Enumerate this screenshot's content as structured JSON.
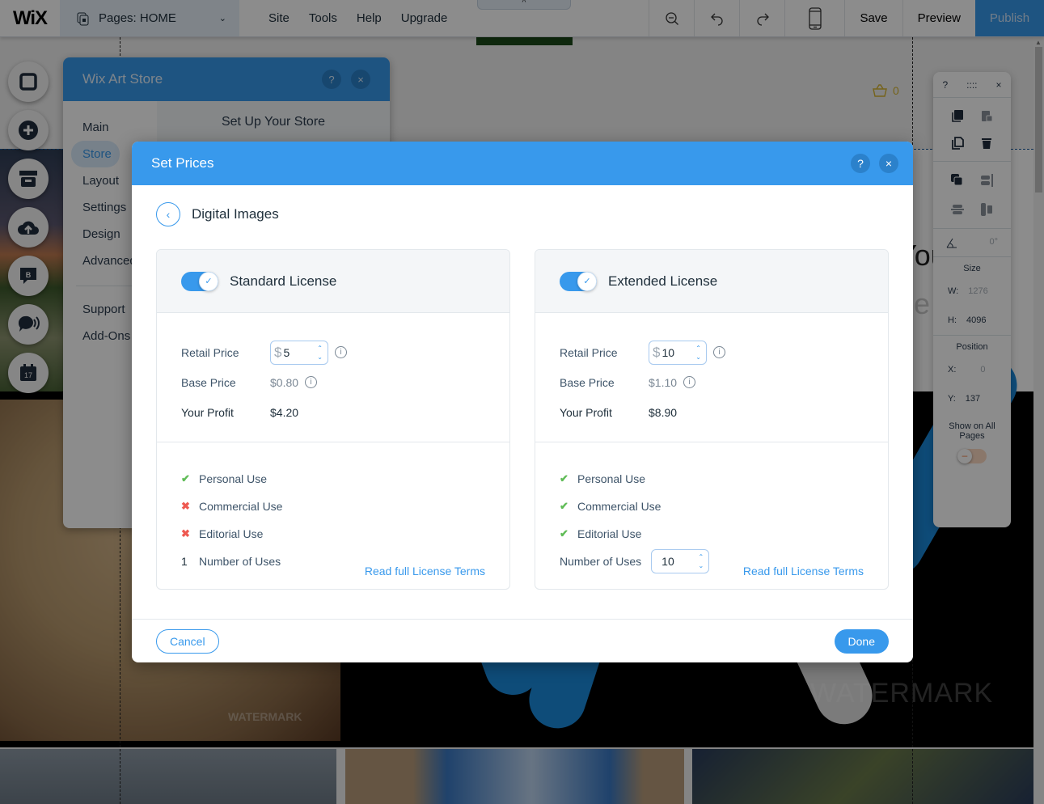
{
  "topbar": {
    "logo": "WiX",
    "pages_label": "Pages: HOME",
    "menu": [
      "Site",
      "Tools",
      "Help",
      "Upgrade"
    ],
    "tools": [
      "zoom-out-icon",
      "undo-icon",
      "redo-icon",
      "mobile-view-icon"
    ],
    "save": "Save",
    "preview": "Preview",
    "publish": "Publish",
    "collapse_glyph": "^"
  },
  "canvas": {
    "cart_count": "0",
    "hero_text_line1": "Your",
    "hero_text_line2": "ge Here",
    "watermark": "WATERMARK",
    "watermark_small": "WATERMARK"
  },
  "rail": {
    "items": [
      "background-icon",
      "add-icon",
      "store-icon",
      "upload-icon",
      "blog-icon",
      "chat-icon",
      "calendar-icon"
    ],
    "calendar_day": "17"
  },
  "app_panel": {
    "title": "Wix Art Store",
    "help": "?",
    "close": "×",
    "nav": [
      "Main",
      "Store",
      "Layout",
      "Settings",
      "Design",
      "Advanced"
    ],
    "nav_active": "Store",
    "nav_secondary": [
      "Support",
      "Add-Ons"
    ],
    "section_title": "Set Up Your Store"
  },
  "float_panel": {
    "help": "?",
    "drag": "::::",
    "close": "×",
    "rotation": "0°",
    "size_label": "Size",
    "w_label": "W:",
    "w_value": "1276",
    "h_label": "H:",
    "h_value": "4096",
    "position_label": "Position",
    "x_label": "X:",
    "x_value": "0",
    "y_label": "Y:",
    "y_value": "137",
    "show_all_label": "Show on All Pages",
    "show_all_on": false
  },
  "modal": {
    "title": "Set Prices",
    "help": "?",
    "close": "×",
    "breadcrumb": "Digital Images",
    "back_glyph": "‹",
    "cancel": "Cancel",
    "done": "Done",
    "accent_color": "#3899ec",
    "licenses": [
      {
        "name": "Standard License",
        "enabled": true,
        "retail_label": "Retail Price",
        "currency": "$",
        "retail_value": "5",
        "base_label": "Base Price",
        "base_value": "$0.80",
        "profit_label": "Your Profit",
        "profit_value": "$4.20",
        "uses": [
          {
            "label": "Personal Use",
            "allowed": true
          },
          {
            "label": "Commercial Use",
            "allowed": false
          },
          {
            "label": "Editorial Use",
            "allowed": false
          }
        ],
        "num_uses_label": "Number of Uses",
        "num_uses_value": "1",
        "terms_link": "Read full License Terms"
      },
      {
        "name": "Extended License",
        "enabled": true,
        "retail_label": "Retail Price",
        "currency": "$",
        "retail_value": "10",
        "base_label": "Base Price",
        "base_value": "$1.10",
        "profit_label": "Your Profit",
        "profit_value": "$8.90",
        "uses": [
          {
            "label": "Personal Use",
            "allowed": true
          },
          {
            "label": "Commercial Use",
            "allowed": true
          },
          {
            "label": "Editorial Use",
            "allowed": true
          }
        ],
        "num_uses_label": "Number of Uses",
        "num_uses_value": "10",
        "terms_link": "Read full License Terms"
      }
    ],
    "glyphs": {
      "check": "✔",
      "cross": "✖",
      "info": "i",
      "up": "⌃",
      "down": "⌄",
      "toggle_check": "✓"
    }
  }
}
